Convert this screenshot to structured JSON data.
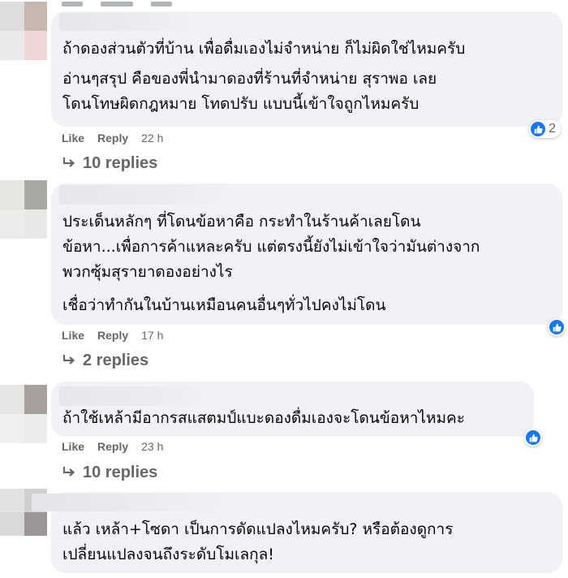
{
  "colors": {
    "bubble_bg": "#f0f2f5",
    "meta_text": "#65676b",
    "like_blue": "#1877f2",
    "text": "#050505"
  },
  "icons": {
    "reaction": "thumbs-up-icon",
    "reply_arrow": "reply-arrow-icon"
  },
  "comments": [
    {
      "lines": [
        "ถ้าดองส่วนตัวที่บ้าน เพื่อดื่มเองไม่จำหน่าย ก็ไม่ผิดใช่ไหมครับ",
        "อ่านๆสรุป คือของพี่นำมาดองที่ร้านที่จำหน่าย สุราพอ เลย",
        "โดนโทษผิดกฎหมาย โทดปรับ แบบนี้เข้าใจถูกไหมครับ"
      ],
      "like_label": "Like",
      "reply_label": "Reply",
      "time": "22 h",
      "reaction_count": "2",
      "replies_label": "10 replies"
    },
    {
      "lines": [
        "ประเด็นหลักๆ ที่โดนข้อหาคือ กระทำในร้านค้าเลยโดน",
        "ข้อหา...เพื่อการค้าแหละครับ แต่ตรงนี้ยังไม่เข้าใจว่ามันต่างจาก",
        "พวกซุ้มสุรายาดองอย่างไร",
        "เชื่อว่าทำกันในบ้านเหมือนคนอื่นๆทั่วไปคงไม่โดน"
      ],
      "like_label": "Like",
      "reply_label": "Reply",
      "time": "17 h",
      "reaction_count": "",
      "replies_label": "2 replies"
    },
    {
      "lines": [
        "ถ้าใช้เหล้ามีอากรสแสตมป์แบะดองดื่มเองจะโดนข้อหาไหมคะ"
      ],
      "like_label": "Like",
      "reply_label": "Reply",
      "time": "23 h",
      "reaction_count": "",
      "replies_label": "10 replies"
    },
    {
      "lines": [
        "แล้ว เหล้า+โซดา เป็นการดัดแปลงไหมครับ? หรือต้องดูการ",
        "เปลี่ยนแปลงจนถึงระดับโมเลกุล!"
      ]
    }
  ]
}
